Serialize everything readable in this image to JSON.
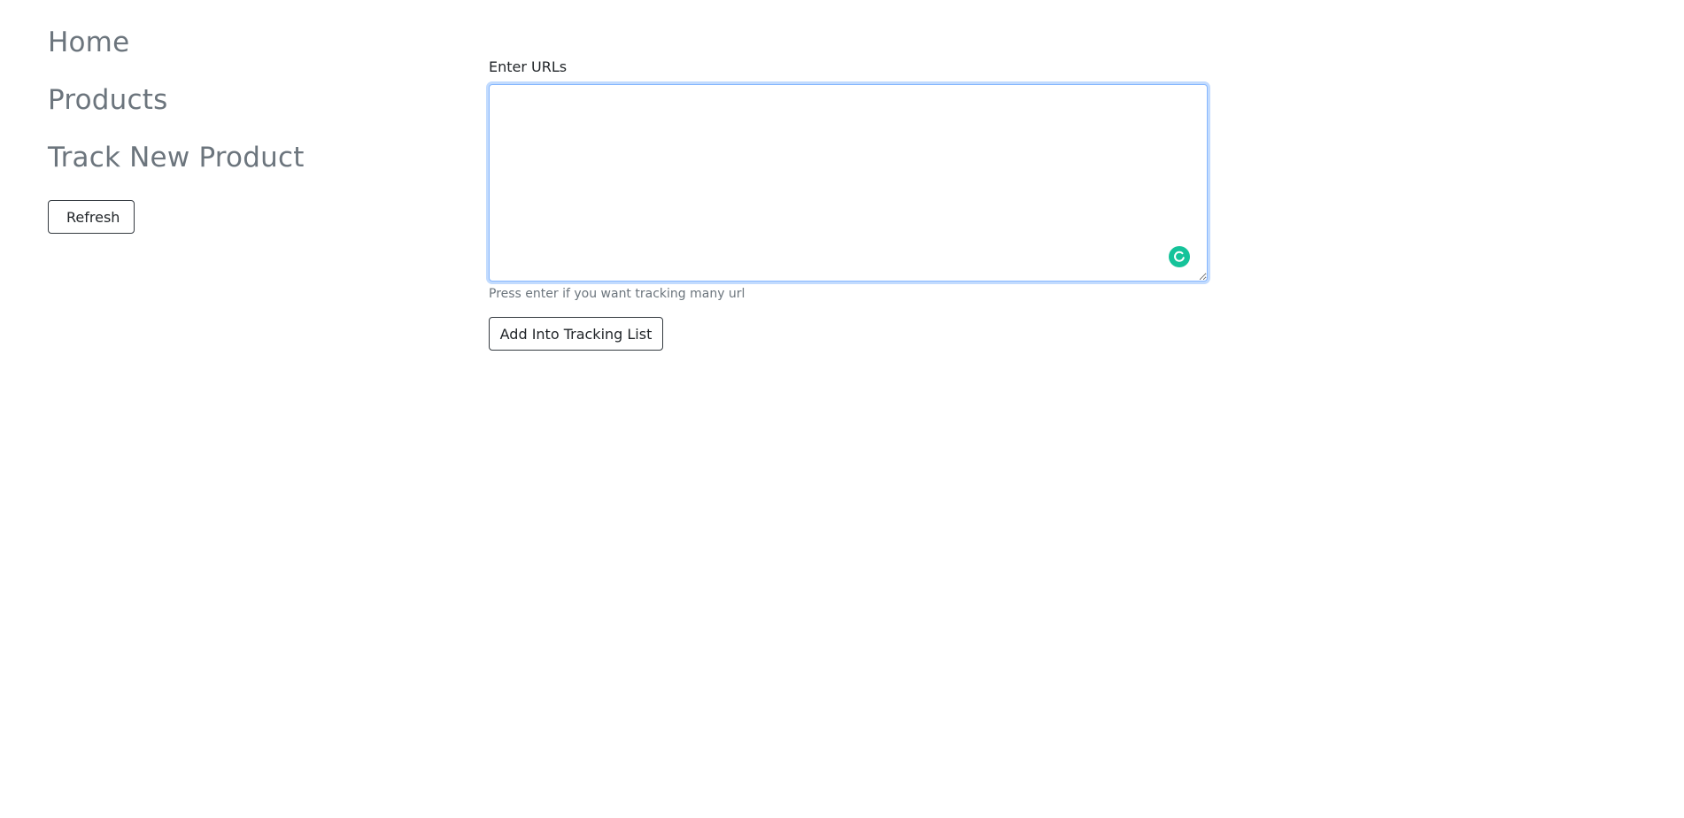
{
  "sidebar": {
    "items": [
      {
        "label": "Home"
      },
      {
        "label": "Products"
      },
      {
        "label": "Track New Product"
      }
    ],
    "refresh_label": "Refresh"
  },
  "form": {
    "label": "Enter URLs",
    "value": "",
    "placeholder": "",
    "help_text": "Press enter if you want tracking many url",
    "submit_label": "Add Into Tracking List",
    "assist_icon": "grammar-assistant-icon",
    "assist_color": "#15c39a"
  },
  "colors": {
    "nav_text": "#6c757d",
    "focus_border": "#86b7fe",
    "button_border": "#343a40"
  }
}
